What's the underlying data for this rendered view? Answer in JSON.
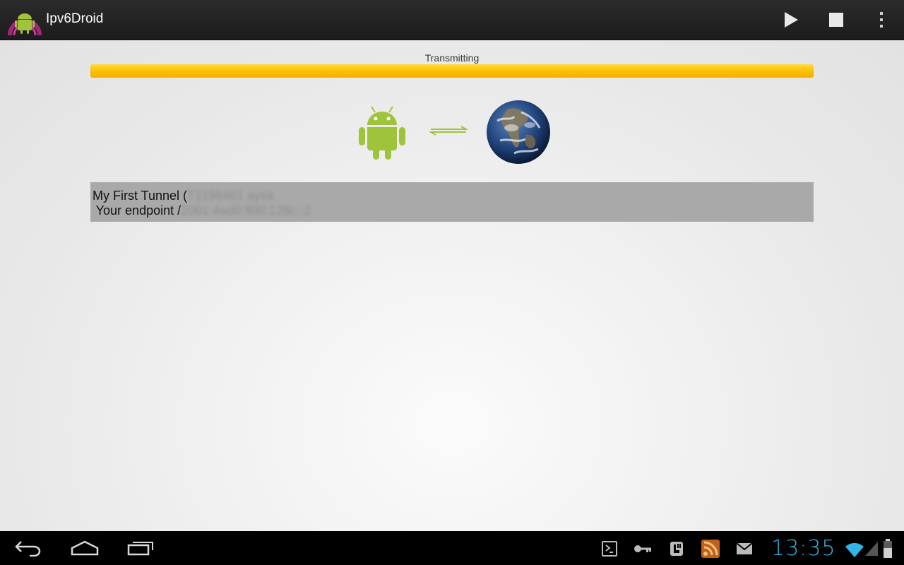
{
  "app": {
    "title": "Ipv6Droid"
  },
  "actionbar": {
    "play_icon": "play-icon",
    "stop_icon": "stop-icon",
    "overflow_icon": "overflow-menu-icon"
  },
  "status": {
    "label": "Transmitting",
    "progress_percent": 100,
    "progress_color": "#fbbf00"
  },
  "graphic": {
    "device_icon": "android-robot-icon",
    "link_icon": "bidirectional-arrows-icon",
    "network_icon": "earth-globe-icon"
  },
  "tunnel": {
    "name": "My First Tunnel",
    "id_prefix": " (",
    "id_blurred": "T1198461 aysa",
    "endpoint_label": " Your endpoint /",
    "endpoint_blurred": "2001:4ad0:ff00:128c::2"
  },
  "system_bar": {
    "clock": "13:35",
    "clock_color": "#33b5e5",
    "notification_icons": [
      "terminal-icon",
      "key-icon",
      "voip-icon",
      "rss-icon",
      "mail-icon"
    ]
  }
}
